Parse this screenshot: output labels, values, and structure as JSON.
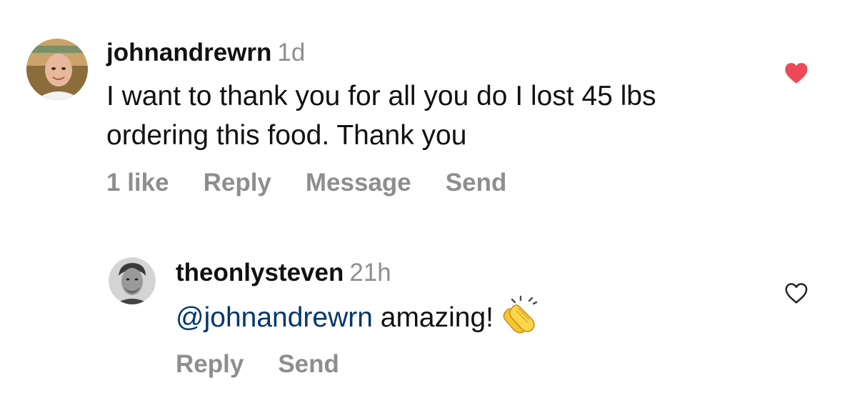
{
  "comments": [
    {
      "username": "johnandrewrn",
      "timestamp": "1d",
      "text": "I want to thank you for all you do I lost 45 lbs ordering this food.  Thank you",
      "liked": true,
      "actions": {
        "likes": "1 like",
        "reply": "Reply",
        "message": "Message",
        "send": "Send"
      }
    }
  ],
  "reply": {
    "username": "theonlysteven",
    "timestamp": "21h",
    "mention": "@johnandrewrn",
    "text": " amazing!",
    "emoji": "clapping-hands",
    "liked": false,
    "actions": {
      "reply": "Reply",
      "send": "Send"
    }
  },
  "colors": {
    "text": "#111111",
    "secondary": "#8e8e8e",
    "mention": "#00376b",
    "heart_liked": "#ed4956"
  }
}
